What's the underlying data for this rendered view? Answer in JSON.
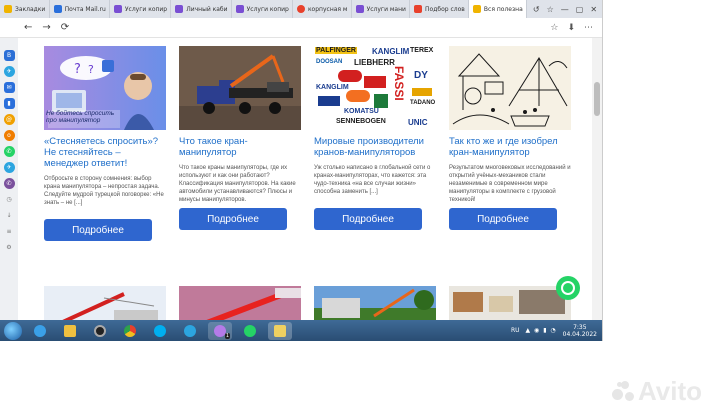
{
  "browser": {
    "tabs": [
      {
        "label": "Закладки",
        "color": "#f0b400"
      },
      {
        "label": "Почта Mail.ru",
        "color": "#2a6fdb"
      },
      {
        "label": "Услуги копир",
        "color": "#7a4fd3"
      },
      {
        "label": "Личный каби",
        "color": "#7a4fd3"
      },
      {
        "label": "Услуги копир",
        "color": "#7a4fd3"
      },
      {
        "label": "корпусная м",
        "color": "#e8412c"
      },
      {
        "label": "Услуги мани",
        "color": "#7a4fd3"
      },
      {
        "label": "Подбор слов",
        "color": "#e8412c"
      },
      {
        "label": "Вся полезна",
        "color": "#f0b400"
      }
    ],
    "controls": [
      "↺",
      "☆",
      "—",
      "▢",
      "✕"
    ],
    "nav": [
      "←",
      "→",
      "⟳"
    ],
    "addr_icons": [
      "☆",
      "⬇",
      "⋯"
    ]
  },
  "sidebar": {
    "icons": [
      {
        "name": "vk-icon",
        "glyph": "В",
        "color": "#2b6fd6"
      },
      {
        "name": "telegram-icon",
        "glyph": "✈",
        "color": "#2ca5e0"
      },
      {
        "name": "mail-icon",
        "glyph": "✉",
        "color": "#2a6fdb"
      },
      {
        "name": "stats-icon",
        "glyph": "▮",
        "color": "#2a6fdb"
      },
      {
        "name": "at-icon",
        "glyph": "@",
        "color": "#f0a000"
      },
      {
        "name": "odnoklassniki-icon",
        "glyph": "o",
        "color": "#f07d00"
      },
      {
        "name": "whatsapp-icon",
        "glyph": "✆",
        "color": "#25d366"
      },
      {
        "name": "telegram-icon-2",
        "glyph": "✈",
        "color": "#2ca5e0"
      },
      {
        "name": "viber-icon",
        "glyph": "✆",
        "color": "#7b519d"
      },
      {
        "name": "clock-icon",
        "glyph": "◷",
        "color": "#888888"
      },
      {
        "name": "download-icon",
        "glyph": "↓",
        "color": "#888888"
      },
      {
        "name": "list-icon",
        "glyph": "≡",
        "color": "#888888"
      },
      {
        "name": "settings-icon",
        "glyph": "⚙",
        "color": "#888888"
      }
    ]
  },
  "cards": [
    {
      "thumb_caption": "Не бойтесь спросить про манипулятор",
      "title": "«Стесняетесь спросить»? Не стесняйтесь – менеджер ответит!",
      "desc": "Отбросьте в сторону сомнения: выбор крана манипулятора – непростая задача. Следуйте мудрой турецкой поговорке: «Не знать – не [...]",
      "button": "Подробнее"
    },
    {
      "title": "Что такое кран-манипулятор",
      "desc": "Что такое краны манипуляторы, где их используют и как они работают? Классификация манипуляторов. На какие автомобили устанавливаются? Плюсы и минусы манипуляторов.",
      "button": "Подробнее"
    },
    {
      "brands": [
        "PALFINGER",
        "KANGLIM",
        "TEREX",
        "DOOSAN",
        "LIEBHERR",
        "DY",
        "KANGLIM",
        "FASSI",
        "KOMATSU",
        "TADANO",
        "SENNEBOGEN",
        "UNIC"
      ],
      "title": "Мировые производители кранов-манипуляторов",
      "desc": "Уж столько написано в глобальной сети о кранах-манипуляторах, что кажется: эта чудо-техника «на все случаи жизни» способна заменить [...]",
      "button": "Подробнее"
    },
    {
      "title": "Так кто же и где изобрел кран-манипулятор",
      "desc": "Результатом многовековых исследований и открытий учёных-механиков стали незаменимые в современном мире манипуляторы в комплекте с грузовой техникой!",
      "button": "Подробнее"
    }
  ],
  "taskbar": {
    "lang": "RU",
    "time": "7:35",
    "date": "04.04.2022",
    "badge": "1"
  },
  "watermark": "Avito"
}
